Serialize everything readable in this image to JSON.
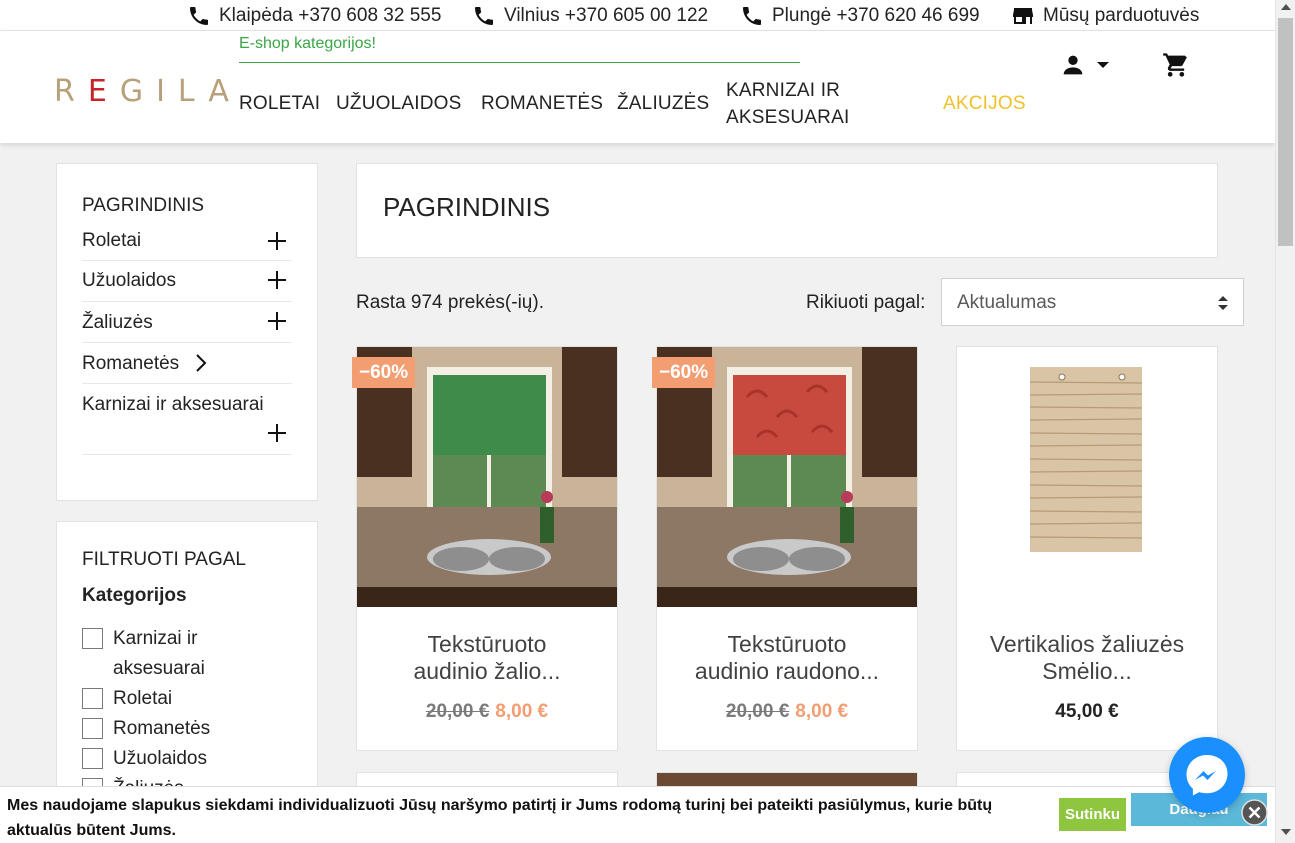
{
  "topbar": {
    "contacts": [
      {
        "icon": "phone-icon",
        "text": "Klaipėda +370 608 32 555"
      },
      {
        "icon": "phone-icon",
        "text": "Vilnius +370 605 00 122"
      },
      {
        "icon": "phone-icon",
        "text": "Plungė +370 620 46 699"
      },
      {
        "icon": "store-icon",
        "text": "Mūsų parduotuvės"
      }
    ]
  },
  "header": {
    "logo": "REGILA",
    "eshop_link": "E-shop kategorijos!",
    "nav": [
      "ROLETAI",
      "UŽUOLAIDOS",
      "ROMANETĖS",
      "ŽALIUZĖS",
      "KARNIZAI IR",
      "AKSESUARAI",
      "AKCIJOS"
    ],
    "accent_color": "#f2c029",
    "green_color": "#3aa645"
  },
  "sidebar": {
    "title": "PAGRINDINIS",
    "categories": [
      "Roletai",
      "Užuolaidos",
      "Žaliuzės",
      "Romanetės",
      "Karnizai ir aksesuarai"
    ],
    "filter_title": "FILTRUOTI PAGAL",
    "filter_group": "Kategorijos",
    "filters": [
      "Karnizai ir",
      "aksesuarai",
      "Roletai",
      "Romanetės",
      "Užuolaidos",
      "Žaliuzės"
    ]
  },
  "main": {
    "title": "PAGRINDINIS",
    "found": "Rasta 974 prekės(-ių).",
    "sort_label": "Rikiuoti pagal:",
    "sort_value": "Aktualumas"
  },
  "products": [
    {
      "name1": "Tekstūruoto",
      "name2": "audinio žalio...",
      "old_price": "20,00 €",
      "price": "8,00 €",
      "badge": "−60%",
      "color": "#4a8f4f"
    },
    {
      "name1": "Tekstūruoto",
      "name2": "audinio raudono...",
      "old_price": "20,00 €",
      "price": "8,00 €",
      "badge": "−60%",
      "color": "#c84a3e"
    },
    {
      "name1": "Vertikalios žaliuzės",
      "name2": "Smėlio...",
      "price": "45,00 €"
    }
  ],
  "cookie": {
    "text": "Mes naudojame slapukus siekdami individualizuoti Jūsų naršymo patirtį ir Jums rodomą turinį bei pateikti pasiūlymus, kurie būtų aktualūs būtent Jums.",
    "agree": "Sutinku",
    "more": "Daugiau"
  }
}
